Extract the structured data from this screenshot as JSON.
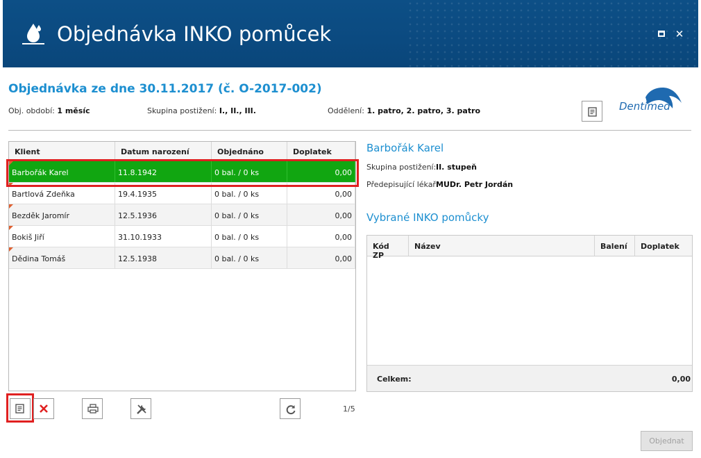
{
  "window": {
    "title": "Objednávka INKO pomůcek"
  },
  "order": {
    "title": "Objednávka ze dne 30.11.2017 (č. O-2017-002)",
    "period_label": "Obj. období:",
    "period_value": "1 měsíc",
    "group_label": "Skupina postižení:",
    "group_value": "I., II., III.",
    "dept_label": "Oddělení:",
    "dept_value": "1. patro, 2. patro, 3. patro"
  },
  "brand": {
    "name": "Dentimed",
    "color": "#1f6ab0"
  },
  "clients_table": {
    "columns": [
      "Klient",
      "Datum narození",
      "Objednáno",
      "Doplatek"
    ],
    "rows": [
      {
        "name": "Barbořák Karel",
        "birth": "11.8.1942",
        "ordered": "0 bal. / 0 ks",
        "payment": "0,00"
      },
      {
        "name": "Bartlová Zdeňka",
        "birth": "19.4.1935",
        "ordered": "0 bal. / 0 ks",
        "payment": "0,00"
      },
      {
        "name": "Bezděk Jaromír",
        "birth": "12.5.1936",
        "ordered": "0 bal. / 0 ks",
        "payment": "0,00"
      },
      {
        "name": "Bokiš Jiří",
        "birth": "31.10.1933",
        "ordered": "0 bal. / 0 ks",
        "payment": "0,00"
      },
      {
        "name": "Dědina Tomáš",
        "birth": "12.5.1938",
        "ordered": "0 bal. / 0 ks",
        "payment": "0,00"
      }
    ],
    "pager": "1/5",
    "selected_color": "#11a611"
  },
  "detail": {
    "client_name": "Barbořák Karel",
    "group_label": "Skupina postižení:",
    "group_value": "II. stupeň",
    "doctor_label": "Předepisující lékař:",
    "doctor_value": "MUDr. Petr Jordán",
    "selected_title": "Vybrané INKO pomůcky",
    "columns": [
      "Kód ZP",
      "Název",
      "Balení",
      "Doplatek"
    ],
    "total_label": "Celkem:",
    "total_value": "0,00"
  },
  "actions": {
    "order_label": "Objednat"
  },
  "icons": [
    "water-drop-icon",
    "maximize-icon",
    "close-icon",
    "note-icon",
    "delete-icon",
    "print-icon",
    "tools-icon",
    "refresh-icon"
  ]
}
